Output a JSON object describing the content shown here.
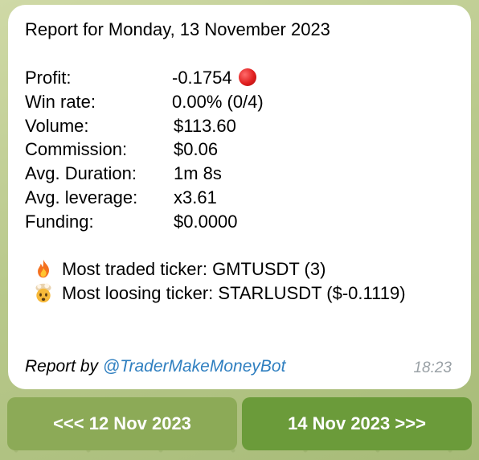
{
  "message": {
    "title": "Report for Monday, 13 November 2023",
    "stats": [
      {
        "label": "Profit:",
        "value": "-0.1754"
      },
      {
        "label": "Win rate:",
        "value": "0.00% (0/4)"
      },
      {
        "label": "Volume:",
        "value": "$113.60"
      },
      {
        "label": "Commission:",
        "value": "$0.06"
      },
      {
        "label": "Avg. Duration:",
        "value": "1m 8s"
      },
      {
        "label": "Avg. leverage:",
        "value": "x3.61"
      },
      {
        "label": "Funding:",
        "value": "$0.0000"
      }
    ],
    "profit_indicator_icon": "red-circle-icon",
    "most_traded": {
      "icon": "fire-icon",
      "text": "Most traded ticker: GMTUSDT (3)"
    },
    "most_loosing": {
      "icon": "exploding-head-icon",
      "text": "Most loosing ticker: STARLUSDT ($-0.1119)"
    },
    "footer": {
      "prefix": "Report by ",
      "link": "@TraderMakeMoneyBot"
    },
    "time": "18:23"
  },
  "buttons": {
    "prev_label": "<<< 12 Nov 2023",
    "next_label": "14 Nov 2023 >>>"
  },
  "colors": {
    "link": "#2f7fc0",
    "button_prev": "#8caa57",
    "button_next": "#6b9b3a",
    "background": "#b9c98c"
  }
}
